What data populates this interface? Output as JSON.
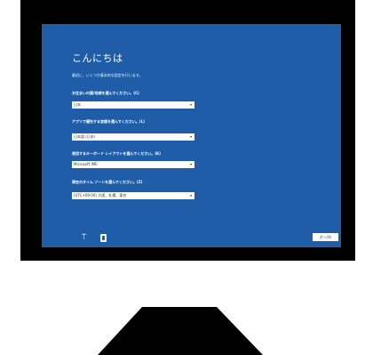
{
  "screen": {
    "title": "こんにちは",
    "subtitle": "最初に、いくつか基本的な設定を行います。",
    "accent_color": "#1f5da8"
  },
  "fields": [
    {
      "label": "お住まいの国/地域を選んでください。(C)",
      "value": "日本"
    },
    {
      "label": "アプリで優先する言語を選んでください。(L)",
      "value": "日本語 (日本)"
    },
    {
      "label": "使用するキーボード レイアウトを選んでください。(K)",
      "value": "Microsoft IME"
    },
    {
      "label": "現在のタイム ゾーンを選んでください。(Z)",
      "value": "(UTC+09:00) 大阪、札幌、東京"
    }
  ],
  "footer": {
    "accessibility_icon": "accessibility-icon",
    "power_icon": "power-icon",
    "next_label": "次へ(N)"
  }
}
